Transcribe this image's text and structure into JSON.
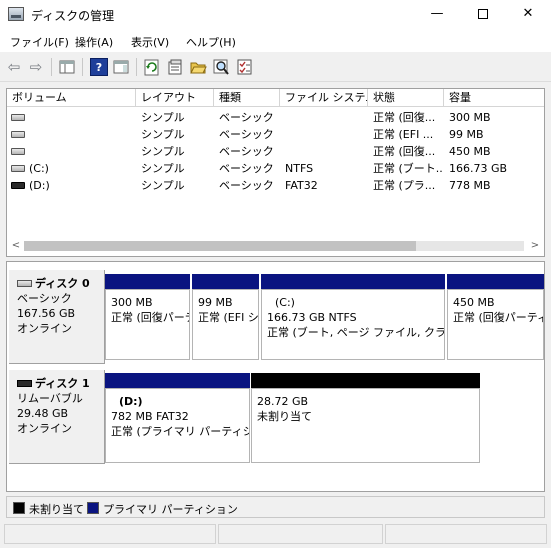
{
  "window": {
    "title": "ディスクの管理",
    "controls": {
      "minimize": "—",
      "close": "✕"
    }
  },
  "menu": [
    "ファイル(F)",
    "操作(A)",
    "表示(V)",
    "ヘルプ(H)"
  ],
  "toolbar": {
    "back_glyph": "⇦",
    "forward_glyph": "⇨",
    "help_glyph": "?"
  },
  "volume_list": {
    "columns": [
      "ボリューム",
      "レイアウト",
      "種類",
      "ファイル システム",
      "状態",
      "容量"
    ],
    "rows": [
      {
        "volume": "",
        "layout": "シンプル",
        "type": "ベーシック",
        "fs": "",
        "status": "正常 (回復...",
        "capacity": "300 MB",
        "icon": "drive-icon"
      },
      {
        "volume": "",
        "layout": "シンプル",
        "type": "ベーシック",
        "fs": "",
        "status": "正常 (EFI ...",
        "capacity": "99 MB",
        "icon": "drive-icon"
      },
      {
        "volume": "",
        "layout": "シンプル",
        "type": "ベーシック",
        "fs": "",
        "status": "正常 (回復...",
        "capacity": "450 MB",
        "icon": "drive-icon"
      },
      {
        "volume": "(C:)",
        "layout": "シンプル",
        "type": "ベーシック",
        "fs": "NTFS",
        "status": "正常 (ブート...",
        "capacity": "166.73 GB",
        "icon": "drive-icon"
      },
      {
        "volume": "(D:)",
        "layout": "シンプル",
        "type": "ベーシック",
        "fs": "FAT32",
        "status": "正常 (プラ...",
        "capacity": "778 MB",
        "icon": "removable-drive-icon"
      }
    ],
    "scroll_left": "<",
    "scroll_right": ">"
  },
  "disks": [
    {
      "name": "ディスク 0",
      "kind": "ベーシック",
      "size": "167.56 GB",
      "state": "オンライン",
      "partitions": [
        {
          "line1": "",
          "line2": "300 MB",
          "line3": "正常 (回復パーティション)"
        },
        {
          "line1": "",
          "line2": "99 MB",
          "line3": "正常 (EFI システム パーティション)"
        },
        {
          "line1": "(C:)",
          "line2": "166.73 GB NTFS",
          "line3": "正常 (ブート, ページ ファイル, クラッシュ ダンプ, ベーシック データ パーティション)"
        },
        {
          "line1": "",
          "line2": "450 MB",
          "line3": "正常 (回復パーティション)"
        }
      ]
    },
    {
      "name": "ディスク 1",
      "kind": "リムーバブル",
      "size": "29.48 GB",
      "state": "オンライン",
      "partitions": [
        {
          "line1": "(D:)",
          "line2": "782 MB FAT32",
          "line3": "正常 (プライマリ パーティション)"
        },
        {
          "line1": "",
          "line2": "28.72 GB",
          "line3": "未割り当て"
        }
      ]
    }
  ],
  "legend": [
    {
      "label": "未割り当て",
      "color": "#000000"
    },
    {
      "label": "プライマリ パーティション",
      "color": "#0a1480"
    }
  ],
  "colors": {
    "primary_partition": "#0a1480",
    "unallocated": "#000000"
  }
}
